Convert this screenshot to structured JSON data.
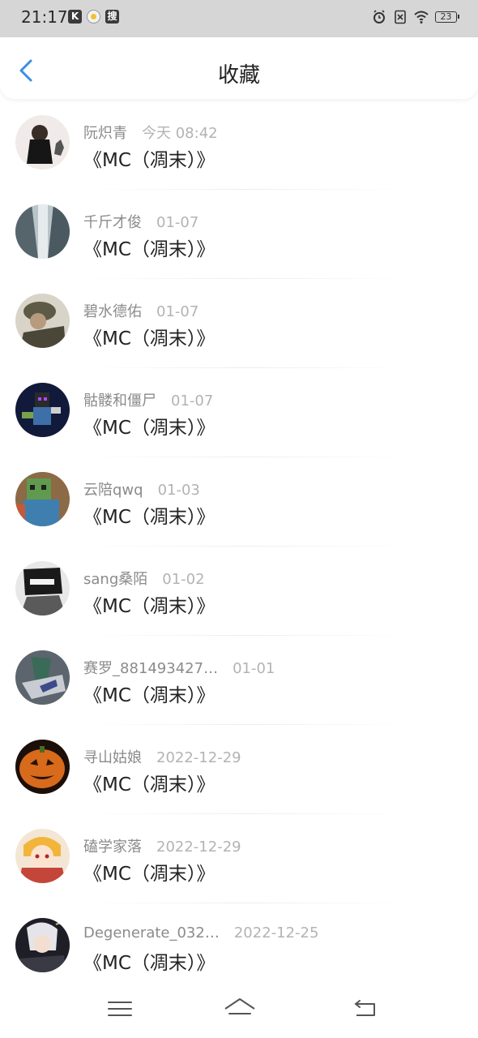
{
  "status_bar": {
    "time": "21:17",
    "left_badges": [
      "K",
      "搜"
    ],
    "battery": "23"
  },
  "header": {
    "title": "收藏",
    "back_icon": "chevron-left-icon",
    "accent": "#3a8ee6"
  },
  "favorites": [
    {
      "user": "阮炽青",
      "date": "今天 08:42",
      "title": "《MC（凋末）》",
      "avatar_color": "#e8e0db"
    },
    {
      "user": "千斤才俊",
      "date": "01-07",
      "title": "《MC（凋末）》",
      "avatar_color": "#8fa0a6"
    },
    {
      "user": "碧水德佑",
      "date": "01-07",
      "title": "《MC（凋末）》",
      "avatar_color": "#6f6a58"
    },
    {
      "user": "骷髅和僵尸",
      "date": "01-07",
      "title": "《MC（凋末）》",
      "avatar_color": "#1e2a5c"
    },
    {
      "user": "云陪qwq",
      "date": "01-03",
      "title": "《MC（凋末）》",
      "avatar_color": "#6e8a4c"
    },
    {
      "user": "sang桑陌",
      "date": "01-02",
      "title": "《MC（凋末）》",
      "avatar_color": "#3c3c3c"
    },
    {
      "user": "赛罗_881493427…",
      "date": "01-01",
      "title": "《MC（凋末）》",
      "avatar_color": "#4d5560"
    },
    {
      "user": "寻山姑娘",
      "date": "2022-12-29",
      "title": "《MC（凋末）》",
      "avatar_color": "#d2661e"
    },
    {
      "user": "磕学家落",
      "date": "2022-12-29",
      "title": "《MC（凋末）》",
      "avatar_color": "#c4463a"
    },
    {
      "user": "Degenerate_032…",
      "date": "2022-12-25",
      "title": "《MC（凋末）》",
      "avatar_color": "#2b2b33"
    }
  ],
  "nav": {
    "menu_icon": "menu-icon",
    "home_icon": "home-icon",
    "back_icon": "back-icon"
  }
}
